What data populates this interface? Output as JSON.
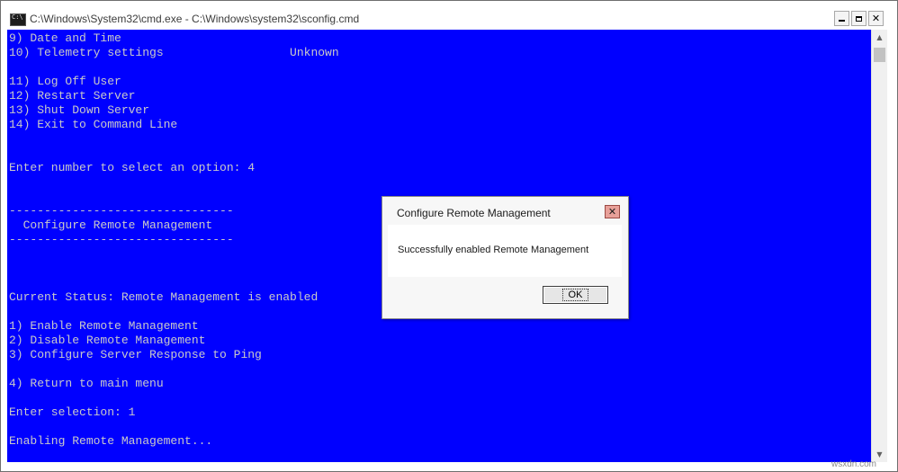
{
  "window": {
    "title": "C:\\Windows\\System32\\cmd.exe - C:\\Windows\\system32\\sconfig.cmd"
  },
  "console": {
    "background": "#0000ff",
    "text_color": "#c9c9c9",
    "lines": [
      "9) Date and Time",
      "10) Telemetry settings                  Unknown",
      "",
      "11) Log Off User",
      "12) Restart Server",
      "13) Shut Down Server",
      "14) Exit to Command Line",
      "",
      "",
      "Enter number to select an option: 4",
      "",
      "",
      "--------------------------------",
      "  Configure Remote Management",
      "--------------------------------",
      "",
      "",
      "",
      "Current Status: Remote Management is enabled",
      "",
      "1) Enable Remote Management",
      "2) Disable Remote Management",
      "3) Configure Server Response to Ping",
      "",
      "4) Return to main menu",
      "",
      "Enter selection: 1",
      "",
      "Enabling Remote Management..."
    ]
  },
  "dialog": {
    "title": "Configure Remote Management",
    "message": "Successfully enabled Remote Management",
    "ok_label": "OK"
  },
  "watermark": "wsxdn.com"
}
